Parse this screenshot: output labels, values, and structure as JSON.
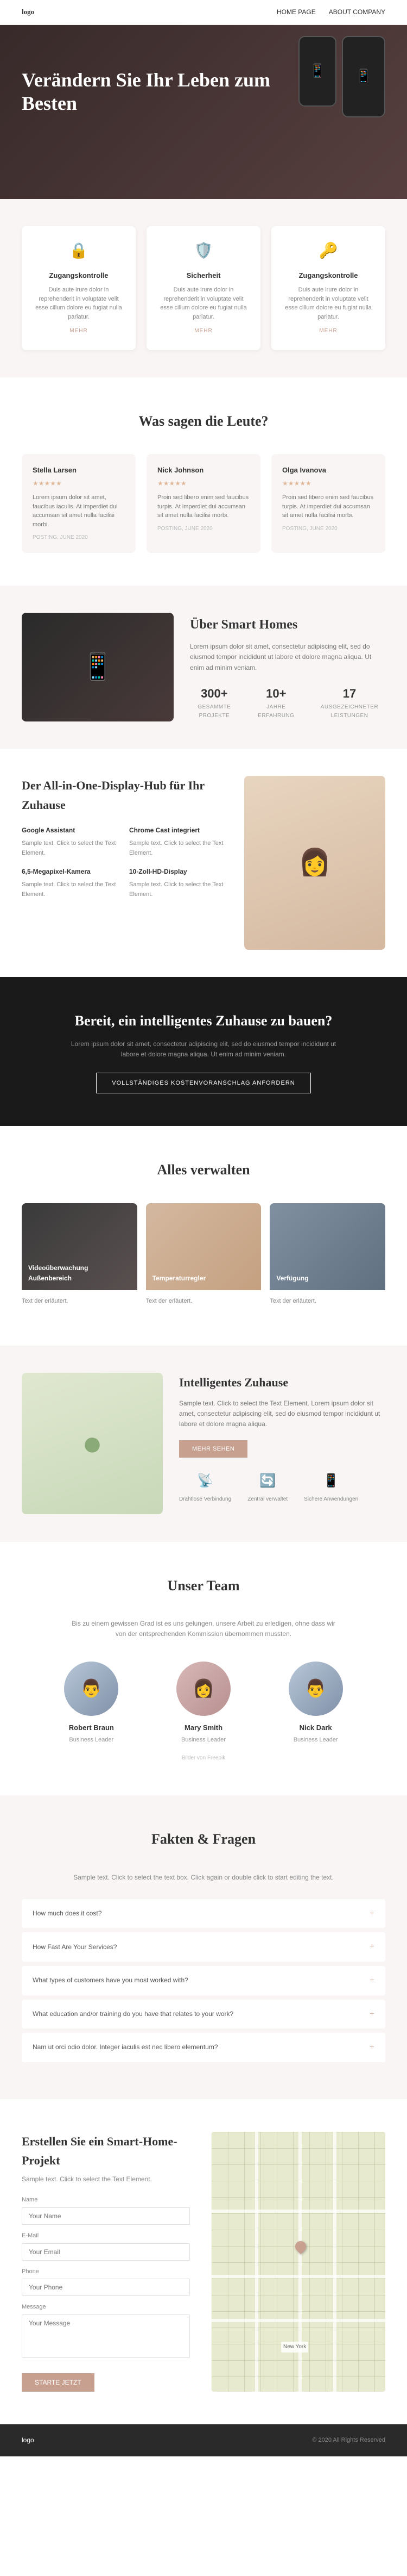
{
  "nav": {
    "logo": "logo",
    "links": [
      "HOME PAGE",
      "ABOUT COMPANY"
    ]
  },
  "hero": {
    "title": "Verändern Sie Ihr Leben zum Besten",
    "phone_label": "Phone UI"
  },
  "cards": {
    "items": [
      {
        "icon": "🔒",
        "title": "Zugangskontrolle",
        "text": "Duis aute irure dolor in reprehenderit in voluptate velit esse cillum dolore eu fugiat nulla pariatur.",
        "link": "MEHR"
      },
      {
        "icon": "🛡️",
        "title": "Sicherheit",
        "text": "Duis aute irure dolor in reprehenderit in voluptate velit esse cillum dolore eu fugiat nulla pariatur.",
        "link": "MEHR"
      },
      {
        "icon": "🔑",
        "title": "Zugangskontrolle",
        "text": "Duis aute irure dolor in reprehenderit in voluptate velit esse cillum dolore eu fugiat nulla pariatur.",
        "link": "MEHR"
      }
    ]
  },
  "testimonials": {
    "section_title": "Was sagen die Leute?",
    "items": [
      {
        "name": "Stella Larsen",
        "stars": "★★★★★",
        "text": "Lorem ipsum dolor sit amet, faucibus iaculis. At imperdiet dui accumsan sit amet nulla facilisi morbi.",
        "date": "POSTING, JUNE 2020"
      },
      {
        "name": "Nick Johnson",
        "stars": "★★★★★",
        "text": "Proin sed libero enim sed faucibus turpis. At imperdiet dui accumsan sit amet nulla facilisi morbi.",
        "date": "POSTING, JUNE 2020"
      },
      {
        "name": "Olga Ivanova",
        "stars": "★★★★★",
        "text": "Proin sed libero enim sed faucibus turpis. At imperdiet dui accumsan sit amet nulla facilisi morbi.",
        "date": "POSTING, JUNE 2020"
      }
    ]
  },
  "smart_homes": {
    "title": "Über Smart Homes",
    "text": "Lorem ipsum dolor sit amet, consectetur adipiscing elit, sed do eiusmod tempor incididunt ut labore et dolore magna aliqua. Ut enim ad minim veniam.",
    "stats": [
      {
        "value": "300+",
        "label": "GESAMMTE PROJEKTE"
      },
      {
        "value": "10+",
        "label": "JAHRE ERFAHRUNG"
      },
      {
        "value": "17",
        "label": "AUSGEZEICHNETER LEISTUNGEN"
      }
    ]
  },
  "all_in_one": {
    "title": "Der All-in-One-Display-Hub für Ihr Zuhause",
    "features": [
      {
        "title": "Google Assistant",
        "text": "Sample text. Click to select the Text Element."
      },
      {
        "title": "Chrome Cast integriert",
        "text": "Sample text. Click to select the Text Element."
      },
      {
        "title": "6,5-Megapixel-Kamera",
        "text": "Sample text. Click to select the Text Element."
      },
      {
        "title": "10-Zoll-HD-Display",
        "text": "Sample text. Click to select the Text Element."
      }
    ]
  },
  "cta": {
    "title": "Bereit, ein intelligentes Zuhause zu bauen?",
    "text": "Lorem ipsum dolor sit amet, consectetur adipiscing elit, sed do eiusmod tempor incididunt ut labore et dolore magna aliqua. Ut enim ad minim veniam.",
    "button": "VOLLSTÄNDIGES KOSTENVORANSCHLAG ANFORDERN"
  },
  "manage": {
    "section_title": "Alles verwalten",
    "items": [
      {
        "title": "Videoüberwachung Außenbereich",
        "text": "Text der erläutert.",
        "color": "dark"
      },
      {
        "title": "Temperaturregler",
        "text": "Text der erläutert.",
        "color": "pink"
      },
      {
        "title": "Verfügung",
        "text": "Text der erläutert.",
        "color": "blue"
      }
    ]
  },
  "intelligent": {
    "title": "Intelligentes Zuhause",
    "text": "Sample text. Click to select the Text Element. Lorem ipsum dolor sit amet, consectetur adipiscing elit, sed do eiusmod tempor incididunt ut labore et dolore magna aliqua.",
    "button": "MEHR SEHEN",
    "icon_features": [
      {
        "icon": "📡",
        "label": "Drahtlose Verbindung"
      },
      {
        "icon": "🔄",
        "label": "Zentral verwaltet"
      },
      {
        "icon": "📱",
        "label": "Sichere Anwendungen"
      }
    ]
  },
  "team": {
    "section_title": "Unser Team",
    "subtitle": "Bis zu einem gewissen Grad ist es uns gelungen, unsere Arbeit zu erledigen, ohne dass wir von der entsprechenden Kommission übernommen mussten.",
    "members": [
      {
        "name": "Robert Braun",
        "role": "Business Leader",
        "gender": "male"
      },
      {
        "name": "Mary Smith",
        "role": "Business Leader",
        "gender": "female"
      },
      {
        "name": "Nick Dark",
        "role": "Business Leader",
        "gender": "male"
      }
    ],
    "photo_credit": "Bilder von Freepik"
  },
  "faq": {
    "section_title": "Fakten & Fragen",
    "subtitle": "Sample text. Click to select the text box. Click again or double click to start editing the text.",
    "items": [
      "How much does it cost?",
      "How Fast Are Your Services?",
      "What types of customers have you most worked with?",
      "What education and/or training do you have that relates to your work?",
      "Nam ut orci odio dolor. Integer iaculis est nec libero elementum?"
    ]
  },
  "contact": {
    "section_title": "Erstellen Sie ein Smart-Home-Projekt",
    "subtitle": "Sample text. Click to select the Text Element.",
    "form": {
      "name_label": "Name",
      "name_placeholder": "Your Name",
      "email_label": "E-Mail",
      "email_placeholder": "Your Email",
      "phone_label": "Phone",
      "phone_placeholder": "Your Phone",
      "message_label": "Message",
      "message_placeholder": "Your Message",
      "submit": "STARTE JETZT"
    },
    "map": {
      "city": "New York"
    }
  },
  "footer": {
    "logo": "logo",
    "copyright": "© 2020 All Rights Reserved"
  }
}
